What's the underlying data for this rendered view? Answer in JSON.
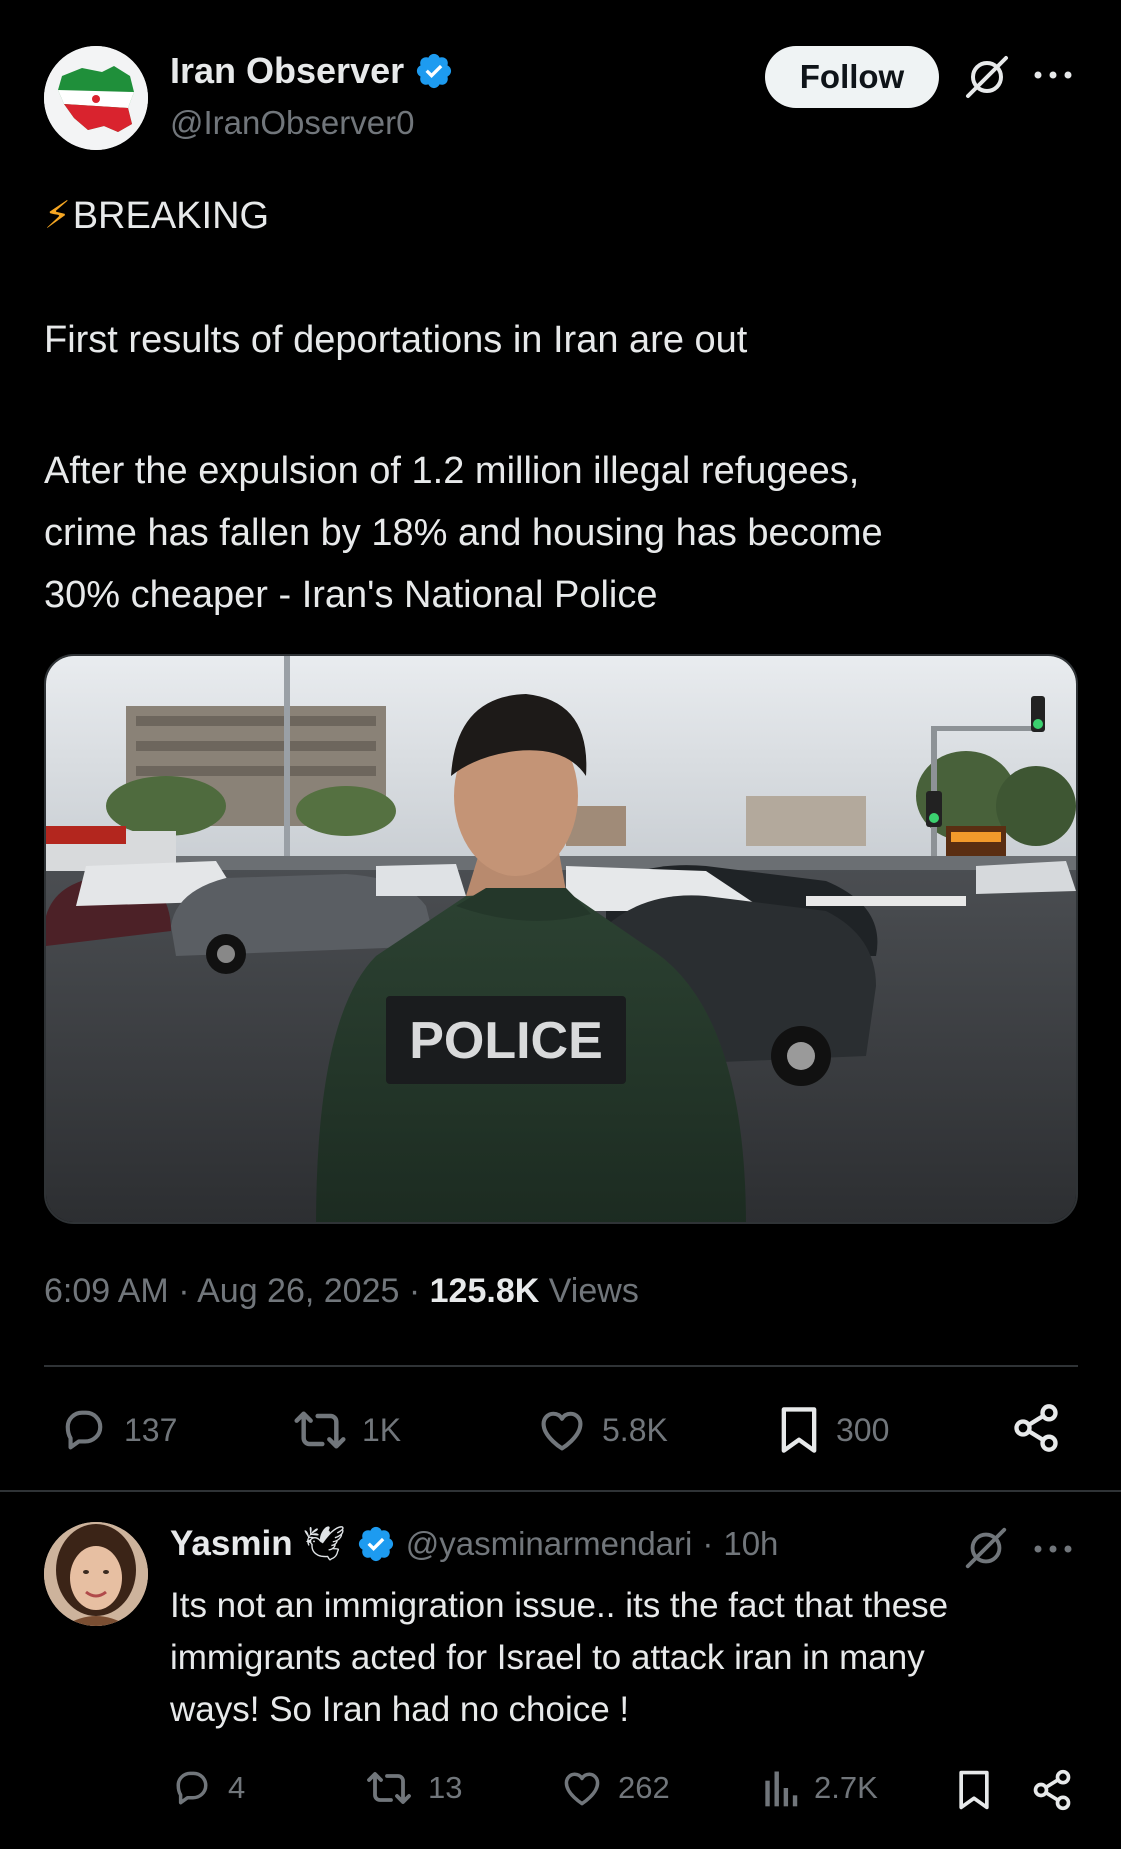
{
  "tweet": {
    "author": {
      "display_name": "Iran Observer",
      "handle": "@IranObserver0",
      "verified": true,
      "avatar_icon": "iran-map-flag-avatar"
    },
    "follow_label": "Follow",
    "breaking_emoji": "⚡",
    "breaking_label": "BREAKING",
    "paragraph_1": "First results of deportations in Iran are out",
    "paragraph_2_lines": [
      "After the expulsion of 1.2 million illegal refugees,",
      "crime has fallen by 18% and housing has become",
      "30% cheaper - Iran's National Police"
    ],
    "media": {
      "jacket_text": "POLICE"
    },
    "time": "6:09 AM",
    "date": "Aug 26, 2025",
    "separator": "·",
    "views_count": "125.8K",
    "views_label": "Views",
    "actions": {
      "replies": "137",
      "reposts": "1K",
      "likes": "5.8K",
      "bookmarks": "300"
    }
  },
  "reply": {
    "display_name": "Yasmin",
    "emoji": "🕊",
    "verified": true,
    "handle": "@yasminarmendari",
    "separator": "·",
    "time": "10h",
    "text_lines": [
      "Its not an immigration issue.. its the fact that these",
      "immigrants acted for Israel to attack iran in many",
      "ways! So Iran had no choice  !"
    ],
    "actions": {
      "replies": "4",
      "reposts": "13",
      "likes": "262",
      "views": "2.7K"
    }
  },
  "colors": {
    "background": "#000000",
    "text_primary": "#e7e9ea",
    "text_secondary": "#71767b",
    "verified_blue": "#1d9bf0",
    "divider": "#2f3336"
  }
}
